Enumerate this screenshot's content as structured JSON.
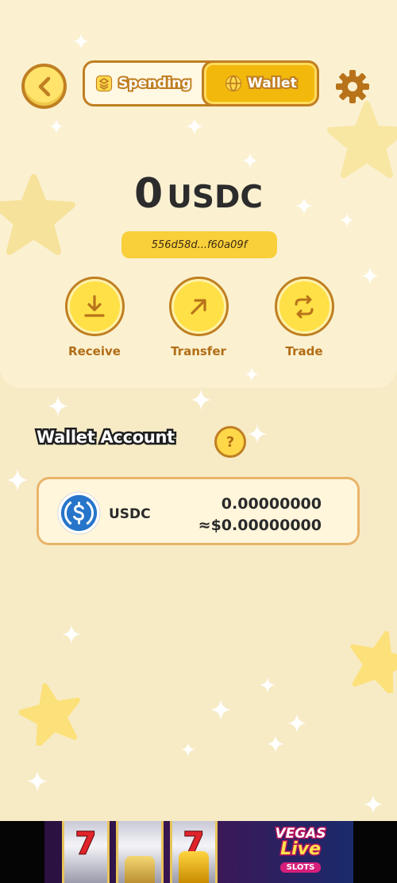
{
  "header": {
    "back_icon": "chevron-left-icon",
    "tabs": [
      {
        "label": "Spending",
        "icon": "stack-icon",
        "active": false
      },
      {
        "label": "Wallet",
        "icon": "globe-icon",
        "active": true
      }
    ],
    "settings_icon": "gear-icon"
  },
  "balance": {
    "amount": "0",
    "currency": "USDC",
    "address": "556d58d...f60a09f"
  },
  "actions": [
    {
      "label": "Receive",
      "icon": "download-icon"
    },
    {
      "label": "Transfer",
      "icon": "arrow-up-right-icon"
    },
    {
      "label": "Trade",
      "icon": "swap-icon"
    }
  ],
  "wallet_account": {
    "title": "Wallet Account",
    "help_label": "?",
    "tokens": [
      {
        "symbol": "USDC",
        "icon": "usdc-coin-icon",
        "amount": "0.00000000",
        "usd_value": "≈$0.00000000"
      }
    ]
  },
  "ad_banner": {
    "logo_line1": "VEGAS",
    "logo_line2": "Live",
    "logo_line3": "SLOTS",
    "reel_symbol": "7"
  },
  "colors": {
    "background": "#f7ebc6",
    "panel": "#fbf1d1",
    "accent_yellow": "#ffe046",
    "accent_brown": "#c07f22",
    "label_brown": "#b26d16",
    "usdc_blue": "#2775ca"
  }
}
